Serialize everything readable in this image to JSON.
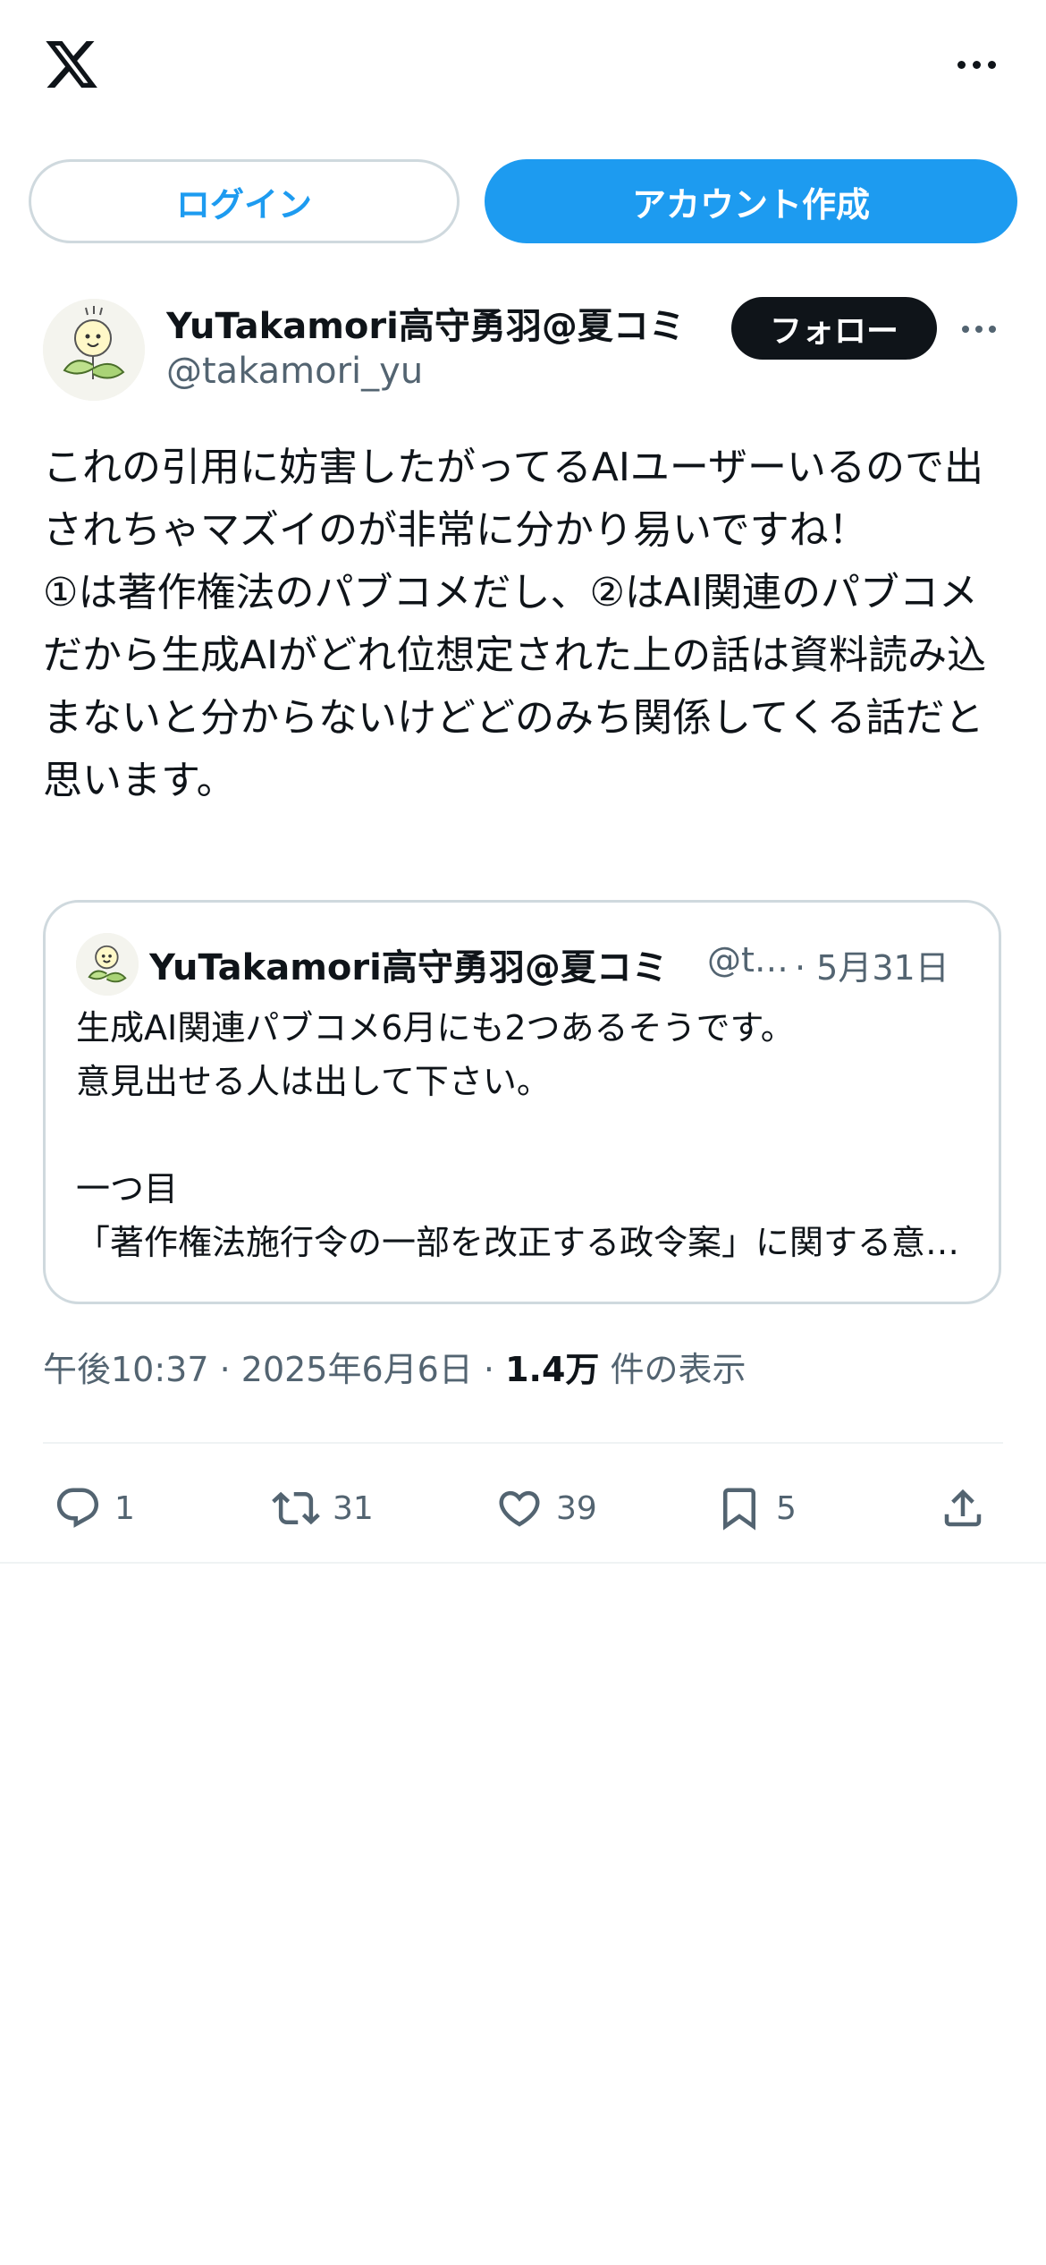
{
  "topbar": {
    "logo_icon": "x-logo-icon",
    "more_icon": "more-horizontal-icon"
  },
  "auth": {
    "login_label": "ログイン",
    "signup_label": "アカウント作成"
  },
  "tweet": {
    "author": {
      "name": "YuTakamori高守勇羽@夏コミ",
      "handle": "@takamori_yu"
    },
    "follow_label": "フォロー",
    "text": "これの引用に妨害したがってるAIユーザーいるので出されちゃマズイのが非常に分かり易いですね！\n①は著作権法のパブコメだし、②はAI関連のパブコメだから生成AIがどれ位想定された上の話は資料読み込まないと分からないけどどのみち関係してくる話だと思います。",
    "quote": {
      "name": "YuTakamori高守勇羽@夏コミ",
      "handle": "@takamori_yu",
      "date": "· 5月31日",
      "lines": [
        "生成AI関連パブコメ6月にも2つあるそうです。",
        "意見出せる人は出して下さい。",
        "",
        "一つ目",
        "「著作権法施行令の一部を改正する政令案」に関する意見募集"
      ]
    },
    "meta": {
      "time": "午後10:37",
      "separator": " · ",
      "date": "2025年6月6日",
      "views_count": "1.4万",
      "views_label": "件の表示"
    },
    "actions": {
      "replies": "1",
      "retweets": "31",
      "likes": "39",
      "bookmarks": "5"
    }
  },
  "colors": {
    "accent": "#1d9bf0",
    "text": "#0f1419",
    "muted": "#536471",
    "border": "#cfd9de"
  }
}
